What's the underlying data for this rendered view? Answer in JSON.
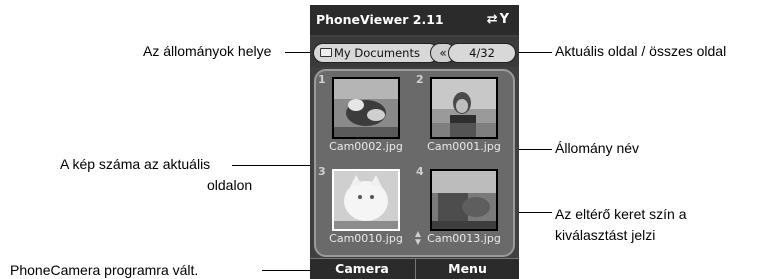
{
  "app": {
    "title": "PhoneViewer 2.11",
    "status_icons": "⇄Y"
  },
  "tabs": {
    "folder": "My Documents",
    "page": "4/32"
  },
  "thumbnails": [
    {
      "number": "1",
      "filename": "Cam0002.jpg",
      "selected": false
    },
    {
      "number": "2",
      "filename": "Cam0001.jpg",
      "selected": false
    },
    {
      "number": "3",
      "filename": "Cam0010.jpg",
      "selected": true
    },
    {
      "number": "4",
      "filename": "Cam0013.jpg",
      "selected": false
    }
  ],
  "softkeys": {
    "left": "Camera",
    "right": "Menu"
  },
  "callouts": {
    "location": "Az állományok helye",
    "page": "Aktuális oldal / összes oldal",
    "filename": "Állomány név",
    "image_number_1": "A kép száma az aktuális",
    "image_number_2": "oldalon",
    "selection_1": "Az eltérő keret szín a",
    "selection_2": "kiválasztást jelzi",
    "camera": "PhoneCamera programra vált."
  },
  "colors": {
    "frame": "#404040",
    "titlebar": "#2b2b2b",
    "selected_border": "#ffffff"
  }
}
